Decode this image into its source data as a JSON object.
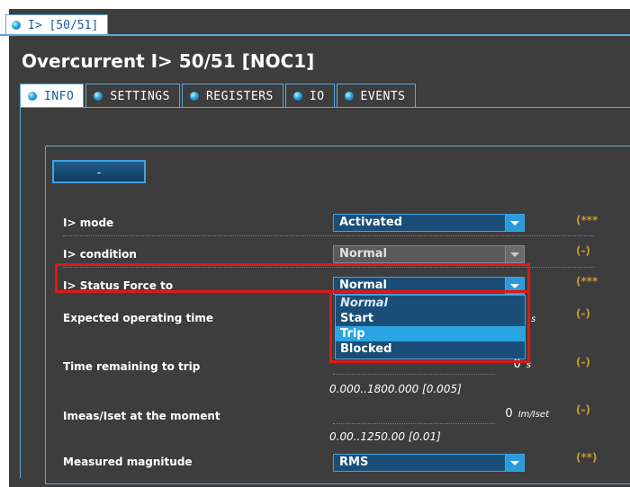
{
  "top_tab": {
    "label": "I> [50/51]"
  },
  "title": "Overcurrent I> 50/51 [NOC1]",
  "tabs": [
    {
      "label": "INFO",
      "active": true
    },
    {
      "label": "SETTINGS",
      "active": false
    },
    {
      "label": "REGISTERS",
      "active": false
    },
    {
      "label": "IO",
      "active": false
    },
    {
      "label": "EVENTS",
      "active": false
    }
  ],
  "collapse_button": {
    "label": "-"
  },
  "rows": {
    "mode": {
      "label": "I> mode",
      "value": "Activated",
      "ref": "(***"
    },
    "condition": {
      "label": "I> condition",
      "value": "Normal",
      "ref": "(-)"
    },
    "status_force": {
      "label": "I> Status Force to",
      "value": "Normal",
      "ref": "(***"
    },
    "expected_time": {
      "label": "Expected operating time",
      "unit": "s",
      "ref": "(-)"
    },
    "time_remaining": {
      "label": "Time remaining to trip",
      "value": "0",
      "unit": "s",
      "range": "0.000..1800.000 [0.005]",
      "ref": "(-)"
    },
    "imeas": {
      "label": "Imeas/Iset at the moment",
      "value": "0",
      "unit": "Im/Iset",
      "range": "0.00..1250.00 [0.01]",
      "ref": "(-)"
    },
    "measured_magnitude": {
      "label": "Measured magnitude",
      "value": "RMS",
      "ref": "(**)"
    }
  },
  "dropdown": {
    "options": [
      "Normal",
      "Start",
      "Trip",
      "Blocked"
    ],
    "selected": "Normal",
    "highlighted": "Trip"
  },
  "colors": {
    "accent": "#2aa4e2",
    "highlight_border": "#e01818",
    "reference_text": "#c99a2a"
  }
}
